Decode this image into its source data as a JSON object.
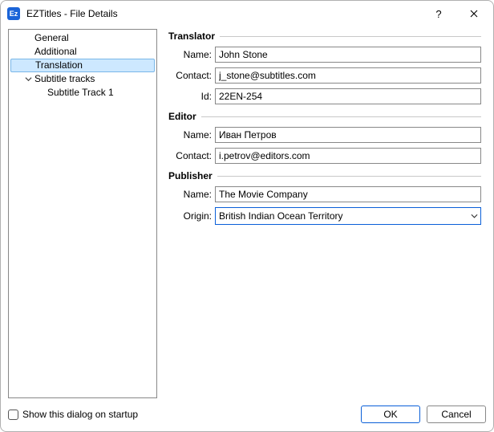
{
  "window": {
    "title": "EZTitles - File Details",
    "icon_text": "Ez"
  },
  "tree": {
    "items": [
      {
        "label": "General"
      },
      {
        "label": "Additional"
      },
      {
        "label": "Translation",
        "selected": true
      },
      {
        "label": "Subtitle tracks",
        "expandable": true,
        "expanded": true
      },
      {
        "label": "Subtitle Track 1",
        "child": true
      }
    ]
  },
  "form": {
    "translator": {
      "header": "Translator",
      "name_label": "Name:",
      "name_value": "John Stone",
      "contact_label": "Contact:",
      "contact_value": "j_stone@subtitles.com",
      "id_label": "Id:",
      "id_value": "22EN-254"
    },
    "editor": {
      "header": "Editor",
      "name_label": "Name:",
      "name_value": "Иван Петров",
      "contact_label": "Contact:",
      "contact_value": "i.petrov@editors.com"
    },
    "publisher": {
      "header": "Publisher",
      "name_label": "Name:",
      "name_value": "The Movie Company",
      "origin_label": "Origin:",
      "origin_value": "British Indian Ocean Territory"
    }
  },
  "footer": {
    "show_on_startup_label": "Show this dialog on startup",
    "show_on_startup_checked": false,
    "ok_label": "OK",
    "cancel_label": "Cancel"
  }
}
